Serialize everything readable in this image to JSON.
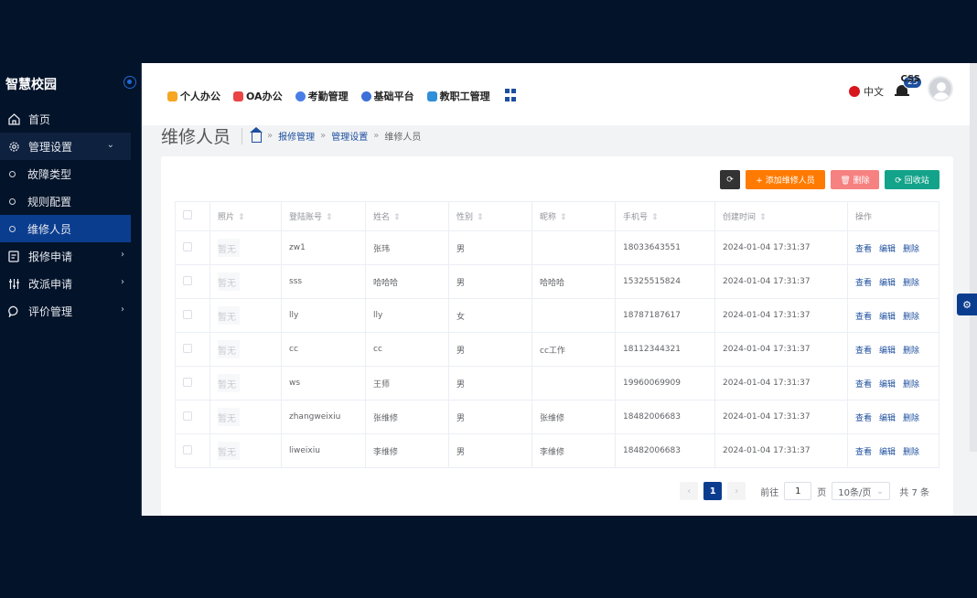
{
  "sidebar": {
    "brand": "智慧校园",
    "items": [
      {
        "label": "首页"
      },
      {
        "label": "管理设置"
      },
      {
        "label": "故障类型"
      },
      {
        "label": "规则配置"
      },
      {
        "label": "维修人员"
      },
      {
        "label": "报修申请"
      },
      {
        "label": "改派申请"
      },
      {
        "label": "评价管理"
      }
    ]
  },
  "topbar": {
    "tabs": [
      {
        "label": "个人办公",
        "color": "#f5a623"
      },
      {
        "label": "OA办公",
        "color": "#e94545"
      },
      {
        "label": "考勤管理",
        "color": "#4a7de8"
      },
      {
        "label": "基础平台",
        "color": "#3c6fd8"
      },
      {
        "label": "教职工管理",
        "color": "#2f8fd8"
      }
    ],
    "lang": "中文",
    "notif_count": "25",
    "user": "CSS"
  },
  "page": {
    "title": "维修人员",
    "breadcrumb": [
      "报修管理",
      "管理设置",
      "维修人员"
    ],
    "sep": "»"
  },
  "toolbar": {
    "refresh": "⟳",
    "add": "+ 添加维修人员",
    "delete": "🗑 删除",
    "recycle": "⟳ 回收站"
  },
  "table": {
    "sort_icon": "⇕",
    "columns": [
      "照片",
      "登陆账号",
      "姓名",
      "性别",
      "昵称",
      "手机号",
      "创建时间",
      "操作"
    ],
    "photo_placeholder": "暂无",
    "ops": [
      "查看",
      "编辑",
      "删除"
    ],
    "rows": [
      {
        "account": "zw1",
        "name": "张玮",
        "gender": "男",
        "nickname": "",
        "phone": "18033643551",
        "created": "2024-01-04 17:31:37"
      },
      {
        "account": "sss",
        "name": "哈哈哈",
        "gender": "男",
        "nickname": "哈哈哈",
        "phone": "15325515824",
        "created": "2024-01-04 17:31:37"
      },
      {
        "account": "lly",
        "name": "lly",
        "gender": "女",
        "nickname": "",
        "phone": "18787187617",
        "created": "2024-01-04 17:31:37"
      },
      {
        "account": "cc",
        "name": "cc",
        "gender": "男",
        "nickname": "cc工作",
        "phone": "18112344321",
        "created": "2024-01-04 17:31:37"
      },
      {
        "account": "ws",
        "name": "王师",
        "gender": "男",
        "nickname": "",
        "phone": "19960069909",
        "created": "2024-01-04 17:31:37"
      },
      {
        "account": "zhangweixiu",
        "name": "张维修",
        "gender": "男",
        "nickname": "张维修",
        "phone": "18482006683",
        "created": "2024-01-04 17:31:37"
      },
      {
        "account": "liweixiu",
        "name": "李维修",
        "gender": "男",
        "nickname": "李维修",
        "phone": "18482006683",
        "created": "2024-01-04 17:31:37"
      }
    ]
  },
  "pagination": {
    "current": "1",
    "goto_label": "前往",
    "goto_value": "1",
    "page_unit": "页",
    "page_size": "10条/页",
    "total": "共 7 条"
  }
}
